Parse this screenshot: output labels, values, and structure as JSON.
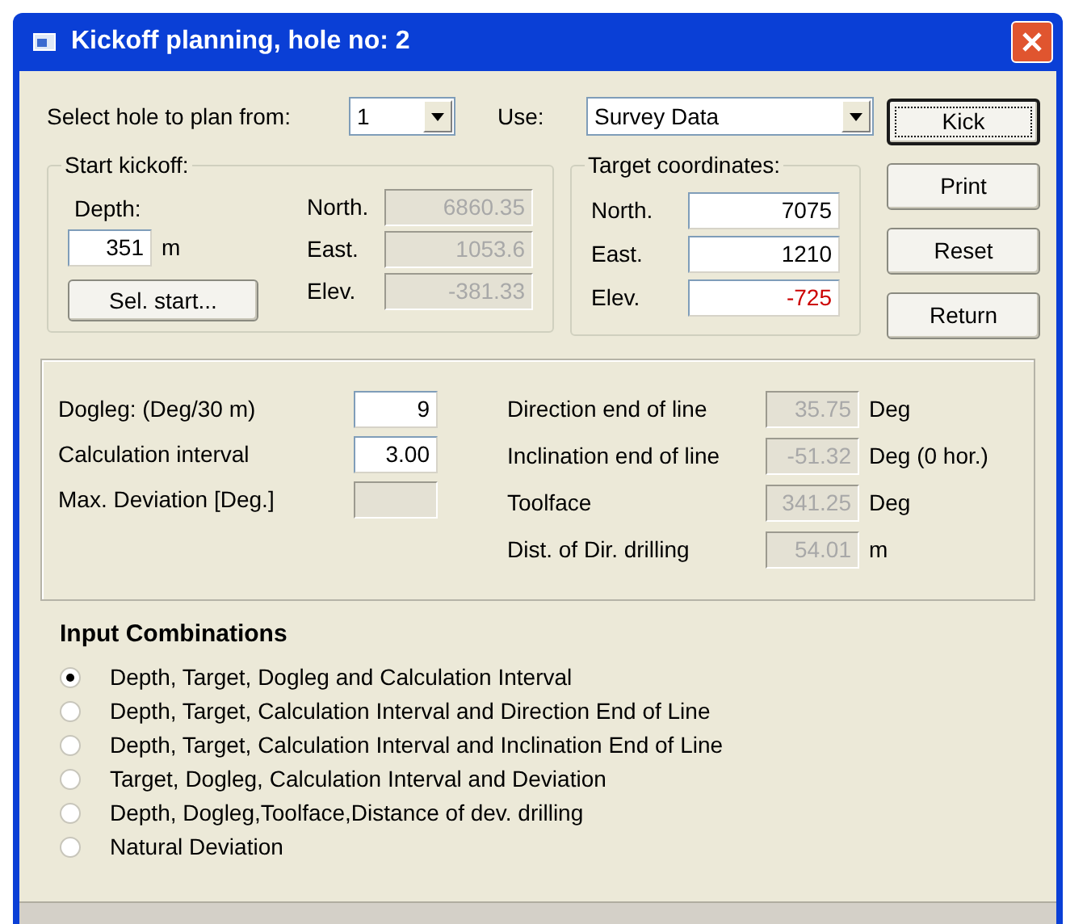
{
  "window": {
    "title": "Kickoff planning, hole no: 2"
  },
  "hole_select": {
    "label": "Select hole to plan from:",
    "value": "1"
  },
  "use_select": {
    "label": "Use:",
    "value": "Survey Data"
  },
  "start_kickoff": {
    "title": "Start kickoff:",
    "depth_label": "Depth:",
    "depth_value": "351",
    "depth_unit": "m",
    "select_button": "Sel. start...",
    "fields": [
      {
        "label": "North.",
        "value": "6860.35",
        "disabled": true
      },
      {
        "label": "East.",
        "value": "1053.6",
        "disabled": true
      },
      {
        "label": "Elev.",
        "value": "-381.33",
        "disabled": true
      }
    ]
  },
  "target": {
    "title": "Target coordinates:",
    "fields": [
      {
        "label": "North.",
        "value": "7075",
        "color": "#000000"
      },
      {
        "label": "East.",
        "value": "1210",
        "color": "#000000"
      },
      {
        "label": "Elev.",
        "value": "-725",
        "color": "#cc0000"
      }
    ]
  },
  "buttons": [
    {
      "label": "Kick",
      "default": true
    },
    {
      "label": "Print",
      "default": false
    },
    {
      "label": "Reset",
      "default": false
    },
    {
      "label": "Return",
      "default": false
    }
  ],
  "parameters": {
    "left": [
      {
        "label": "Dogleg: (Deg/30 m)",
        "value": "9",
        "disabled": false
      },
      {
        "label": "Calculation interval",
        "value": "3.00",
        "disabled": false
      },
      {
        "label": "Max. Deviation [Deg.]",
        "disabled": true
      }
    ],
    "right": [
      {
        "label": "Direction end of line",
        "value": "35.75",
        "unit": "Deg",
        "disabled": true
      },
      {
        "label": "Inclination end of line",
        "value": "-51.32",
        "unit": "Deg (0 hor.)",
        "disabled": true
      },
      {
        "label": "Toolface",
        "value": "341.25",
        "unit": "Deg",
        "disabled": true
      },
      {
        "label": "Dist. of Dir. drilling",
        "value": "54.01",
        "unit": "m",
        "disabled": true
      }
    ]
  },
  "input_combinations": {
    "title": "Input Combinations",
    "options": [
      {
        "label": "Depth, Target, Dogleg and Calculation Interval",
        "selected": true
      },
      {
        "label": "Depth, Target, Calculation Interval and Direction End of Line",
        "selected": false
      },
      {
        "label": "Depth, Target, Calculation Interval and Inclination End of Line",
        "selected": false
      },
      {
        "label": "Target, Dogleg, Calculation Interval and Deviation",
        "selected": false
      },
      {
        "label": "Depth, Dogleg,Toolface,Distance of dev. drilling",
        "selected": false
      },
      {
        "label": "Natural Deviation",
        "selected": false
      }
    ]
  }
}
